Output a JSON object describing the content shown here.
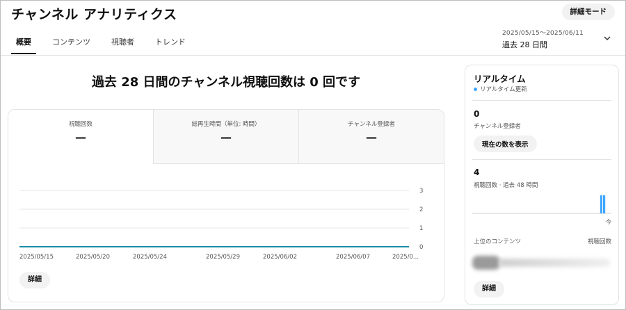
{
  "header": {
    "title": "チャンネル アナリティクス",
    "advanced_mode_label": "詳細モード",
    "tabs": [
      {
        "label": "概要",
        "active": true
      },
      {
        "label": "コンテンツ",
        "active": false
      },
      {
        "label": "視聴者",
        "active": false
      },
      {
        "label": "トレンド",
        "active": false
      }
    ],
    "date_range": {
      "range": "2025/05/15～2025/06/11",
      "period": "過去 28 日間",
      "chevron_icon": "chevron-down-icon"
    }
  },
  "main": {
    "headline": "過去 28 日間のチャンネル視聴回数は 0 回です",
    "metrics": [
      {
        "label": "視聴回数",
        "value": "—",
        "active": true
      },
      {
        "label": "総再生時間（単位: 時間）",
        "value": "—",
        "active": false
      },
      {
        "label": "チャンネル登録者",
        "value": "—",
        "active": false
      }
    ],
    "detail_label": "詳細"
  },
  "chart_data": {
    "type": "line",
    "x": [
      "2025/05/15",
      "2025/05/20",
      "2025/05/24",
      "2025/05/29",
      "2025/06/02",
      "2025/06/07",
      "2025/06/11"
    ],
    "x_tick_labels": [
      "2025/05/15",
      "2025/05/20",
      "2025/05/24",
      "2025/05/29",
      "2025/06/02",
      "2025/06/07",
      "2025/0..."
    ],
    "series": [
      {
        "values": [
          0,
          0,
          0,
          0,
          0,
          0,
          0
        ]
      }
    ],
    "y_ticks": [
      0,
      1,
      2,
      3
    ],
    "ylim": [
      0,
      3
    ],
    "grid": true,
    "line_color": "#1c8ca8"
  },
  "realtime": {
    "title": "リアルタイム",
    "status": "リアルタイム更新",
    "subscribers_value": "0",
    "subscribers_label": "チャンネル登録者",
    "show_count_label": "現在の数を表示",
    "views_value": "4",
    "views_label": "視聴回数 · 過去 48 時間",
    "sparkline_bars": [
      0,
      0,
      0,
      0,
      0,
      0,
      0,
      0,
      0,
      0,
      0,
      0,
      0,
      0,
      0,
      0,
      0,
      0,
      0,
      0,
      0,
      0,
      0,
      0,
      0,
      0,
      0,
      0,
      0,
      0,
      0,
      0,
      0,
      0,
      0,
      0,
      0,
      0,
      0,
      0,
      0,
      0,
      0,
      0,
      2,
      2,
      0,
      0
    ],
    "bar_color": "#3ea6ff",
    "now_label": "今",
    "top_content_label": "上位のコンテンツ",
    "views_column_label": "視聴回数",
    "detail_label": "詳細"
  }
}
